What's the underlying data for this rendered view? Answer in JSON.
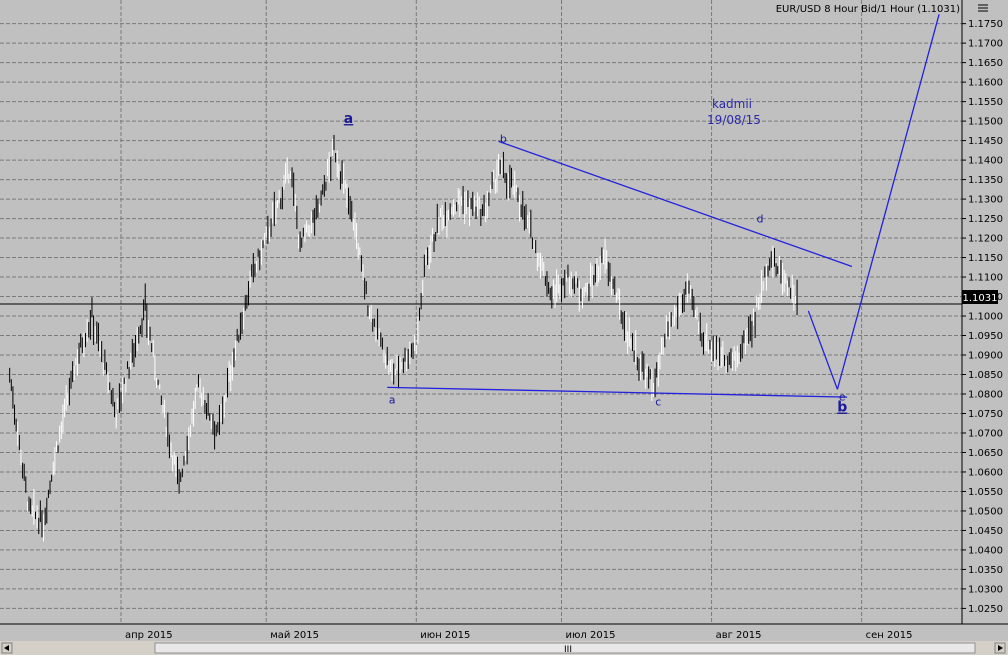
{
  "chart_data": {
    "type": "ohlc",
    "title": "EUR/USD 8 Hour Bid/1 Hour (1.1031)",
    "current_price": 1.1031,
    "current_price_label": "1.1031",
    "ylim": [
      1.021,
      1.1785
    ],
    "y_ticks": [
      "1.0250",
      "1.0300",
      "1.0350",
      "1.0400",
      "1.0450",
      "1.0500",
      "1.0550",
      "1.0600",
      "1.0650",
      "1.0700",
      "1.0750",
      "1.0800",
      "1.0850",
      "1.0900",
      "1.0950",
      "1.1000",
      "1.1050",
      "1.1100",
      "1.1150",
      "1.1200",
      "1.1250",
      "1.1300",
      "1.1350",
      "1.1400",
      "1.1450",
      "1.1500",
      "1.1550",
      "1.1600",
      "1.1650",
      "1.1700",
      "1.1750"
    ],
    "x_labels": [
      {
        "label": "апр 2015",
        "date": "2015-04-01"
      },
      {
        "label": "май 2015",
        "date": "2015-05-01"
      },
      {
        "label": "июн 2015",
        "date": "2015-06-01"
      },
      {
        "label": "июл 2015",
        "date": "2015-07-01"
      },
      {
        "label": "авг 2015",
        "date": "2015-08-01"
      },
      {
        "label": "сен 2015",
        "date": "2015-09-01"
      }
    ],
    "xlim": [
      "2015-03-07",
      "2015-09-30"
    ],
    "grid": true,
    "series": [
      {
        "x": "2015-03-09",
        "y": 1.085
      },
      {
        "x": "2015-03-13",
        "y": 1.05
      },
      {
        "x": "2015-03-16",
        "y": 1.047
      },
      {
        "x": "2015-03-18",
        "y": 1.062
      },
      {
        "x": "2015-03-23",
        "y": 1.09
      },
      {
        "x": "2015-03-26",
        "y": 1.1
      },
      {
        "x": "2015-03-31",
        "y": 1.075
      },
      {
        "x": "2015-04-06",
        "y": 1.102
      },
      {
        "x": "2015-04-09",
        "y": 1.08
      },
      {
        "x": "2015-04-13",
        "y": 1.057
      },
      {
        "x": "2015-04-17",
        "y": 1.082
      },
      {
        "x": "2015-04-21",
        "y": 1.07
      },
      {
        "x": "2015-04-24",
        "y": 1.088
      },
      {
        "x": "2015-04-28",
        "y": 1.11
      },
      {
        "x": "2015-05-01",
        "y": 1.12
      },
      {
        "x": "2015-05-06",
        "y": 1.138
      },
      {
        "x": "2015-05-08",
        "y": 1.118
      },
      {
        "x": "2015-05-12",
        "y": 1.128
      },
      {
        "x": "2015-05-15",
        "y": 1.143
      },
      {
        "x": "2015-05-19",
        "y": 1.125
      },
      {
        "x": "2015-05-22",
        "y": 1.103
      },
      {
        "x": "2015-05-25",
        "y": 1.092
      },
      {
        "x": "2015-05-27",
        "y": 1.085
      },
      {
        "x": "2015-06-01",
        "y": 1.093
      },
      {
        "x": "2015-06-03",
        "y": 1.115
      },
      {
        "x": "2015-06-06",
        "y": 1.125
      },
      {
        "x": "2015-06-10",
        "y": 1.13
      },
      {
        "x": "2015-06-15",
        "y": 1.126
      },
      {
        "x": "2015-06-18",
        "y": 1.138
      },
      {
        "x": "2015-06-22",
        "y": 1.131
      },
      {
        "x": "2015-06-25",
        "y": 1.12
      },
      {
        "x": "2015-06-29",
        "y": 1.105
      },
      {
        "x": "2015-07-02",
        "y": 1.11
      },
      {
        "x": "2015-07-06",
        "y": 1.106
      },
      {
        "x": "2015-07-10",
        "y": 1.115
      },
      {
        "x": "2015-07-14",
        "y": 1.098
      },
      {
        "x": "2015-07-17",
        "y": 1.088
      },
      {
        "x": "2015-07-20",
        "y": 1.082
      },
      {
        "x": "2015-07-23",
        "y": 1.096
      },
      {
        "x": "2015-07-27",
        "y": 1.107
      },
      {
        "x": "2015-07-30",
        "y": 1.095
      },
      {
        "x": "2015-08-03",
        "y": 1.09
      },
      {
        "x": "2015-08-06",
        "y": 1.088
      },
      {
        "x": "2015-08-10",
        "y": 1.1
      },
      {
        "x": "2015-08-13",
        "y": 1.115
      },
      {
        "x": "2015-08-17",
        "y": 1.108
      },
      {
        "x": "2015-08-19",
        "y": 1.1031
      }
    ],
    "annotations": {
      "note_author": "kadmii",
      "note_date": "19/08/15",
      "wave_labels": [
        {
          "text": "a",
          "x": "2015-05-18",
          "y": 1.1495,
          "style": "big"
        },
        {
          "text": "a",
          "x": "2015-05-27",
          "y": 1.0775,
          "style": "small"
        },
        {
          "text": "b",
          "x": "2015-06-19",
          "y": 1.1445,
          "style": "small"
        },
        {
          "text": "c",
          "x": "2015-07-21",
          "y": 1.077,
          "style": "small"
        },
        {
          "text": "d",
          "x": "2015-08-11",
          "y": 1.124,
          "style": "small"
        },
        {
          "text": "e",
          "x": "2015-08-28",
          "y": 1.0783,
          "style": "tiny"
        },
        {
          "text": "b",
          "x": "2015-08-28",
          "y": 1.0755,
          "style": "big"
        }
      ],
      "trendlines": [
        {
          "from": {
            "x": "2015-05-26",
            "y": 1.0817
          },
          "to": {
            "x": "2015-08-29",
            "y": 1.0792
          }
        },
        {
          "from": {
            "x": "2015-06-18",
            "y": 1.1448
          },
          "to": {
            "x": "2015-08-30",
            "y": 1.1127
          }
        },
        {
          "from": {
            "x": "2015-08-21",
            "y": 1.1013
          },
          "to": {
            "x": "2015-08-27",
            "y": 1.0812
          }
        },
        {
          "from": {
            "x": "2015-08-27",
            "y": 1.0812
          },
          "to": {
            "x": "2015-09-17",
            "y": 1.1774
          }
        }
      ]
    }
  },
  "colors": {
    "background": "#c0c0c0",
    "gridline": "#7a7a7a",
    "price_bar": "#000000",
    "price_bar_up": "#ffffff",
    "trendline": "#2222dd",
    "label": "#1a1a99",
    "current_price_line": "#000000",
    "current_price_tag": "#000000"
  },
  "scrollbar": {
    "thumb_glyph": "III"
  },
  "icons": {
    "corner": "settings-icon"
  }
}
